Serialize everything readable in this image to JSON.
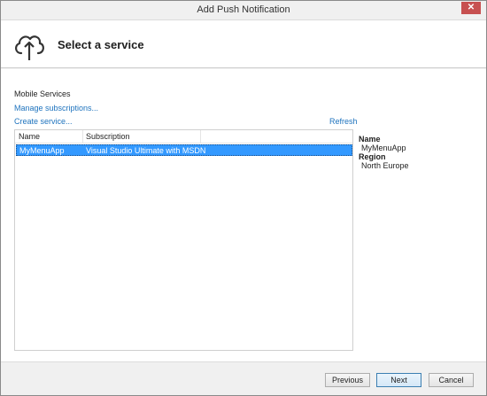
{
  "window": {
    "title": "Add Push Notification",
    "close_label": "✕"
  },
  "header": {
    "title": "Select a service",
    "icon": "cloud-upload-icon"
  },
  "mobile_services": {
    "section_label": "Mobile Services",
    "manage_link": "Manage subscriptions...",
    "create_link": "Create service...",
    "refresh_link": "Refresh"
  },
  "service_list": {
    "columns": [
      "Name",
      "Subscription"
    ],
    "rows": [
      {
        "name": "MyMenuApp",
        "subscription": "Visual Studio Ultimate with MSDN",
        "selected": true
      }
    ]
  },
  "details": {
    "name_label": "Name",
    "name_value": "MyMenuApp",
    "region_label": "Region",
    "region_value": "North Europe"
  },
  "footer": {
    "previous_label": "Previous",
    "next_label": "Next",
    "cancel_label": "Cancel"
  },
  "colors": {
    "selection": "#3399ff",
    "link": "#1e73be",
    "close_button": "#c75050"
  }
}
